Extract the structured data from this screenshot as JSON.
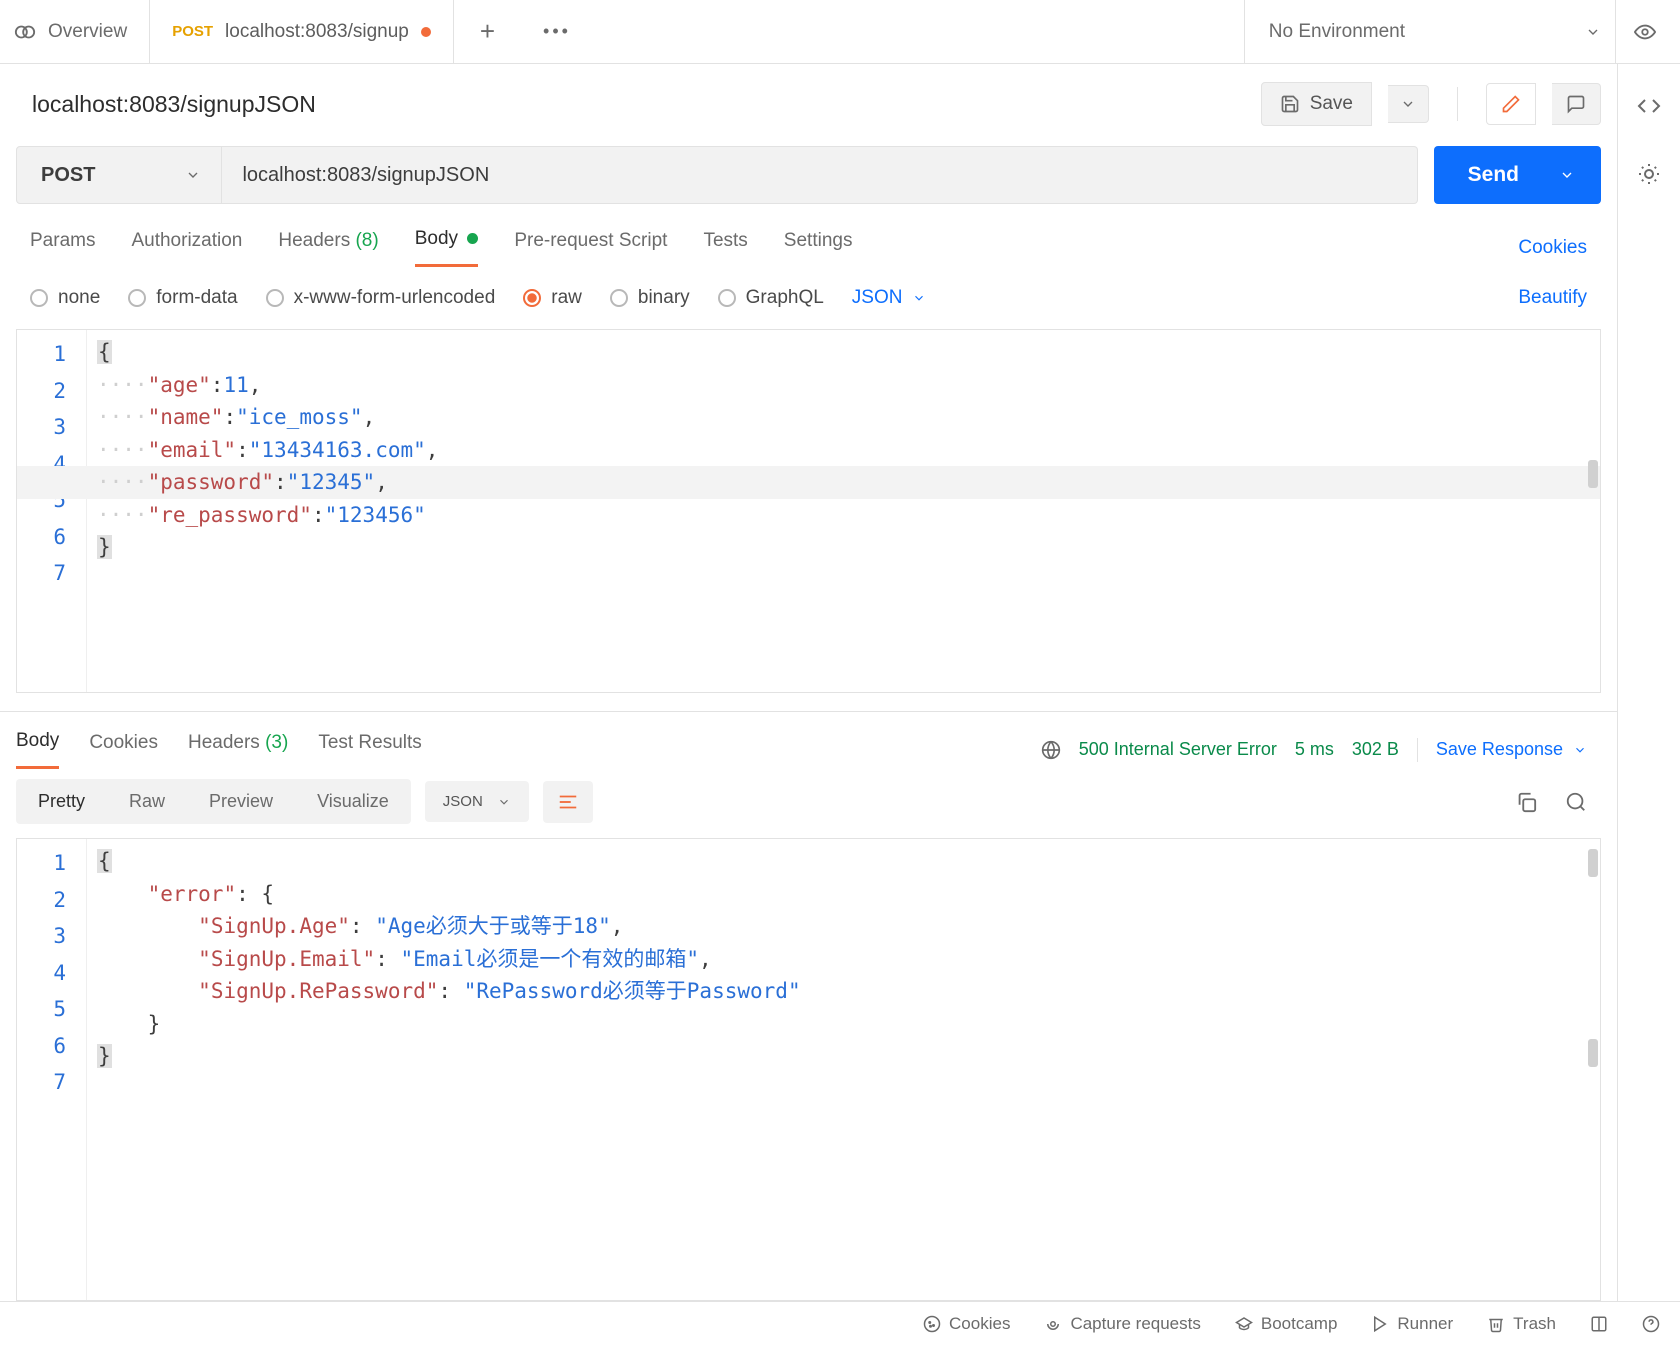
{
  "tabs": {
    "overview": "Overview",
    "active": {
      "method": "POST",
      "title": "localhost:8083/signup"
    }
  },
  "environment": {
    "selected": "No Environment"
  },
  "request": {
    "title": "localhost:8083/signupJSON",
    "save_label": "Save",
    "method": "POST",
    "url": "localhost:8083/signupJSON",
    "send_label": "Send"
  },
  "reqTabs": {
    "params": "Params",
    "auth": "Authorization",
    "headers_label": "Headers",
    "headers_count": "(8)",
    "body": "Body",
    "prereq": "Pre-request Script",
    "tests": "Tests",
    "settings": "Settings",
    "cookies": "Cookies"
  },
  "bodyTypes": {
    "none": "none",
    "formdata": "form-data",
    "urlencoded": "x-www-form-urlencoded",
    "raw": "raw",
    "binary": "binary",
    "graphql": "GraphQL",
    "json": "JSON",
    "beautify": "Beautify"
  },
  "bodyPayload": {
    "age": 11,
    "name": "ice_moss",
    "email": "13434163.com",
    "password": "12345",
    "re_password": "123456"
  },
  "response": {
    "tabs": {
      "body": "Body",
      "cookies": "Cookies",
      "headers_label": "Headers",
      "headers_count": "(3)",
      "tests": "Test Results"
    },
    "status": "500 Internal Server Error",
    "time": "5 ms",
    "size": "302 B",
    "save": "Save Response",
    "view": {
      "pretty": "Pretty",
      "raw": "Raw",
      "preview": "Preview",
      "visualize": "Visualize",
      "format": "JSON"
    },
    "payload": {
      "error_key": "error",
      "age_key": "SignUp.Age",
      "age_val": "Age必须大于或等于18",
      "email_key": "SignUp.Email",
      "email_val": "Email必须是一个有效的邮箱",
      "repw_key": "SignUp.RePassword",
      "repw_val": "RePassword必须等于Password"
    }
  },
  "footer": {
    "cookies": "Cookies",
    "capture": "Capture requests",
    "bootcamp": "Bootcamp",
    "runner": "Runner",
    "trash": "Trash"
  }
}
